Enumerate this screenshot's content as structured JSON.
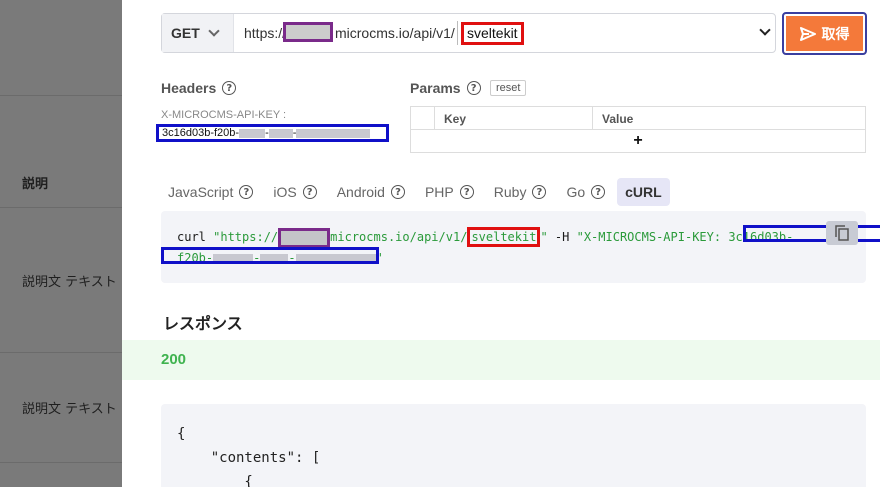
{
  "background": {
    "label_description": "説明",
    "row_text_1": "説明文 テキスト",
    "row_text_2": "説明文 テキスト"
  },
  "request": {
    "method": "GET",
    "url_prefix": "https://",
    "url_domain_path": "microcms.io/api/v1/",
    "endpoint": "sveltekit",
    "fetch_label": "取得"
  },
  "headers": {
    "title": "Headers",
    "key_name": "X-MICROCMS-API-KEY :",
    "key_value_visible": "3c16d03b-f20b-"
  },
  "params": {
    "title": "Params",
    "reset_label": "reset",
    "columns": [
      "Key",
      "Value"
    ],
    "add_label": "+"
  },
  "tabs": [
    {
      "label": "JavaScript",
      "active": false
    },
    {
      "label": "iOS",
      "active": false
    },
    {
      "label": "Android",
      "active": false
    },
    {
      "label": "PHP",
      "active": false
    },
    {
      "label": "Ruby",
      "active": false
    },
    {
      "label": "Go",
      "active": false
    },
    {
      "label": "cURL",
      "active": true
    }
  ],
  "code": {
    "cmd": "curl ",
    "str_open": "\"https://",
    "str_mid": "microcms.io/api/v1/",
    "endpoint": "sveltekit",
    "str_close": "\"",
    "flag": " -H ",
    "header_str": "\"X-MICROCMS-API-KEY: 3c16d03b-",
    "line2_start": "f20b-",
    "line2_end": "\""
  },
  "response": {
    "heading": "レスポンス",
    "status": "200",
    "json_lines": [
      "{",
      "    \"contents\": [",
      "        {"
    ]
  },
  "colors": {
    "accent": "#f4793a",
    "status_ok": "#3fb34f",
    "highlight_red": "#e01010",
    "highlight_blue": "#1010c8",
    "highlight_purple": "#7a2a8a"
  }
}
